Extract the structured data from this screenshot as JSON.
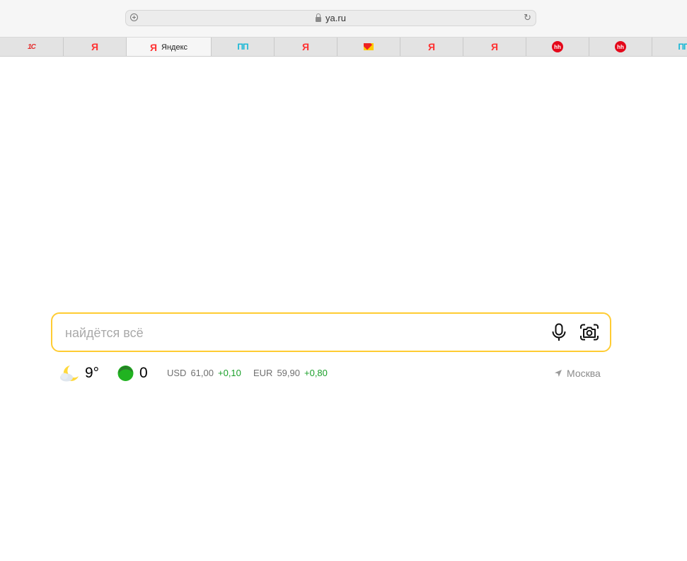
{
  "browser": {
    "address": "ya.ru",
    "tabs": [
      {
        "icon": "1c-icon",
        "glyph": "1С",
        "label": ""
      },
      {
        "icon": "yandex-icon",
        "glyph": "Я",
        "label": ""
      },
      {
        "icon": "yandex-icon",
        "glyph": "Я",
        "label": "Яндекс",
        "active": true
      },
      {
        "icon": "pp-icon",
        "glyph": "ПП",
        "label": ""
      },
      {
        "icon": "yandex-icon",
        "glyph": "Я",
        "label": ""
      },
      {
        "icon": "mail-icon",
        "glyph": "",
        "label": ""
      },
      {
        "icon": "yandex-icon",
        "glyph": "Я",
        "label": ""
      },
      {
        "icon": "yandex-icon",
        "glyph": "Я",
        "label": ""
      },
      {
        "icon": "hh-icon",
        "glyph": "hh",
        "label": ""
      },
      {
        "icon": "hh-icon",
        "glyph": "hh",
        "label": ""
      },
      {
        "icon": "pp-icon",
        "glyph": "ПП",
        "label": ""
      }
    ]
  },
  "search": {
    "placeholder": "найдётся всё"
  },
  "widgets": {
    "weather": {
      "temp": "9°"
    },
    "traffic": {
      "level": "0"
    },
    "rates": [
      {
        "code": "USD",
        "value": "61,00",
        "change": "+0,10"
      },
      {
        "code": "EUR",
        "value": "59,90",
        "change": "+0,80"
      }
    ],
    "location": "Москва"
  },
  "colors": {
    "search_border": "#ffcc33",
    "rate_up": "#1a9f29",
    "yandex_red": "#ff3333"
  }
}
